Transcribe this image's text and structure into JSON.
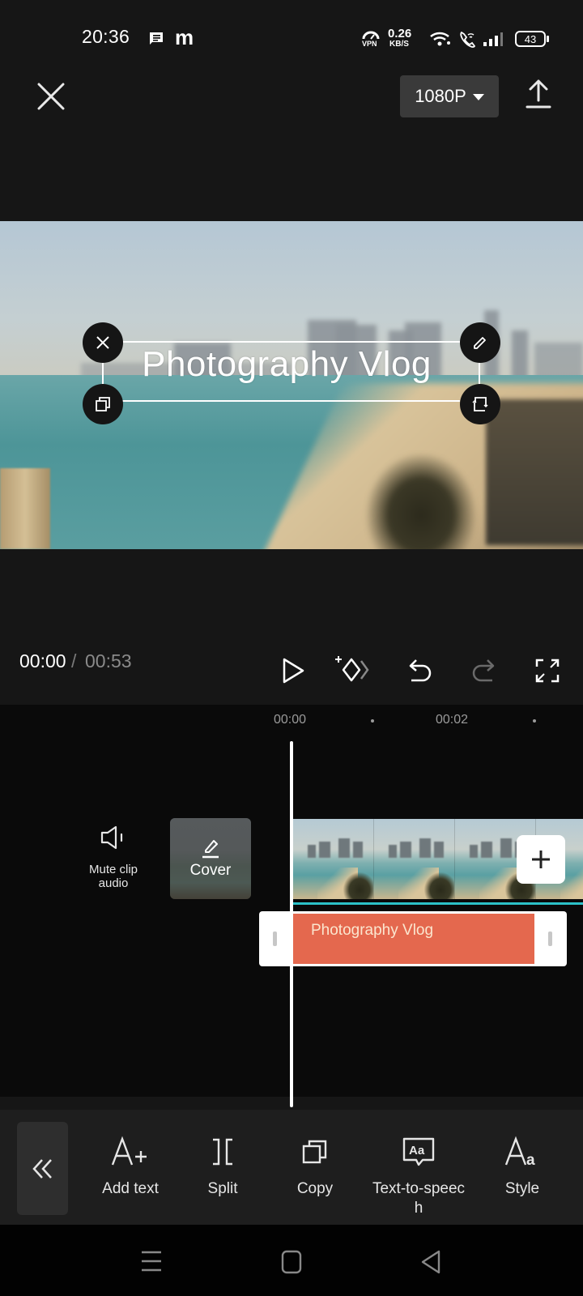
{
  "status_bar": {
    "time": "20:36",
    "notification_icons": [
      "message-icon",
      "m-app-icon"
    ],
    "vpn_label": "VPN",
    "net_speed_value": "0.26",
    "net_speed_unit": "KB/S",
    "battery_level": "43",
    "system_icons": [
      "vpn-icon",
      "wifi-icon",
      "wifi-calling-icon",
      "signal-icon",
      "battery-icon"
    ]
  },
  "top_bar": {
    "close_icon": "close-icon",
    "resolution": "1080P",
    "export_icon": "export-upload-icon"
  },
  "preview": {
    "overlay_text": "Photography Vlog",
    "handles": [
      "delete-icon",
      "edit-pencil-icon",
      "duplicate-icon",
      "rotate-scale-icon"
    ]
  },
  "playback": {
    "current_time": "00:00",
    "separator": "/",
    "total_time": "00:53",
    "controls": [
      "play-icon",
      "keyframe-icon",
      "undo-icon",
      "redo-icon",
      "fullscreen-icon"
    ]
  },
  "timeline": {
    "ruler": [
      "00:00",
      "00:02"
    ],
    "mute_label_line1": "Mute clip",
    "mute_label_line2": "audio",
    "cover_label": "Cover",
    "text_clip_label": "Photography Vlog",
    "add_clip_icon": "plus-icon",
    "clip_accent_color": "#2cc1c8",
    "text_clip_color": "#e4684e"
  },
  "toolbar": {
    "back_icon": "double-chevron-left-icon",
    "items": [
      {
        "label": "Add text",
        "icon": "add-text-icon"
      },
      {
        "label": "Split",
        "icon": "split-icon"
      },
      {
        "label": "Copy",
        "icon": "copy-icon"
      },
      {
        "label": "Text-to-speech",
        "label_line1": "Text-to-speec",
        "label_line2": "h",
        "icon": "text-to-speech-icon"
      },
      {
        "label": "Style",
        "icon": "style-icon"
      }
    ]
  },
  "nav_bar": {
    "buttons": [
      "recents-menu-icon",
      "home-icon",
      "back-icon"
    ]
  }
}
